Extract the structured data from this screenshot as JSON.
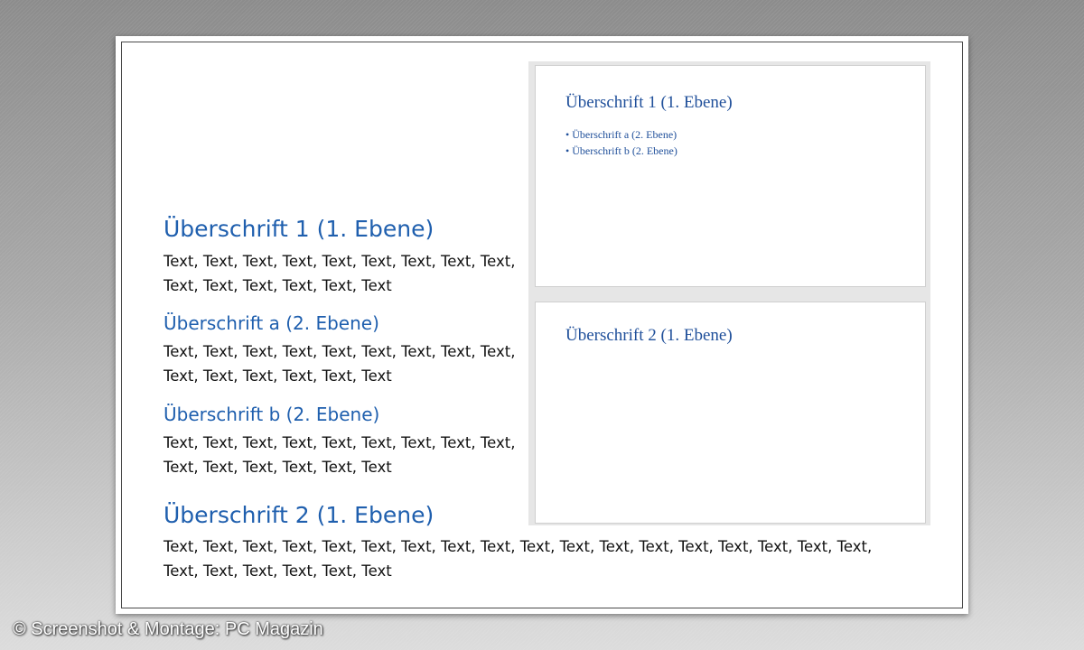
{
  "document": {
    "sections": [
      {
        "heading": "Überschrift 1 (1. Ebene)",
        "text_line1": "Text, Text, Text, Text, Text, Text, Text, Text, Text,",
        "text_line2": "Text, Text, Text, Text, Text, Text"
      },
      {
        "heading": "Überschrift a (2. Ebene)",
        "text_line1": "Text, Text, Text, Text, Text, Text, Text, Text, Text,",
        "text_line2": "Text, Text, Text, Text, Text, Text"
      },
      {
        "heading": "Überschrift b (2. Ebene)",
        "text_line1": "Text, Text, Text, Text, Text, Text, Text, Text, Text,",
        "text_line2": "Text, Text, Text, Text, Text, Text"
      },
      {
        "heading": "Überschrift 2 (1. Ebene)",
        "text_line1": "Text, Text, Text, Text, Text, Text, Text, Text, Text, Text, Text, Text, Text, Text, Text, Text, Text, Text,",
        "text_line2": "Text, Text, Text, Text, Text, Text"
      }
    ]
  },
  "slides": [
    {
      "title": "Überschrift 1 (1. Ebene)",
      "bullets": [
        "• Überschrift a (2. Ebene)",
        "• Überschrift b (2. Ebene)"
      ]
    },
    {
      "title": "Überschrift 2 (1. Ebene)"
    }
  ],
  "credit": "© Screenshot & Montage: PC Magazin",
  "colors": {
    "heading": "#1f5fae",
    "slide_title": "#1f4f9a",
    "body_text": "#111111"
  }
}
